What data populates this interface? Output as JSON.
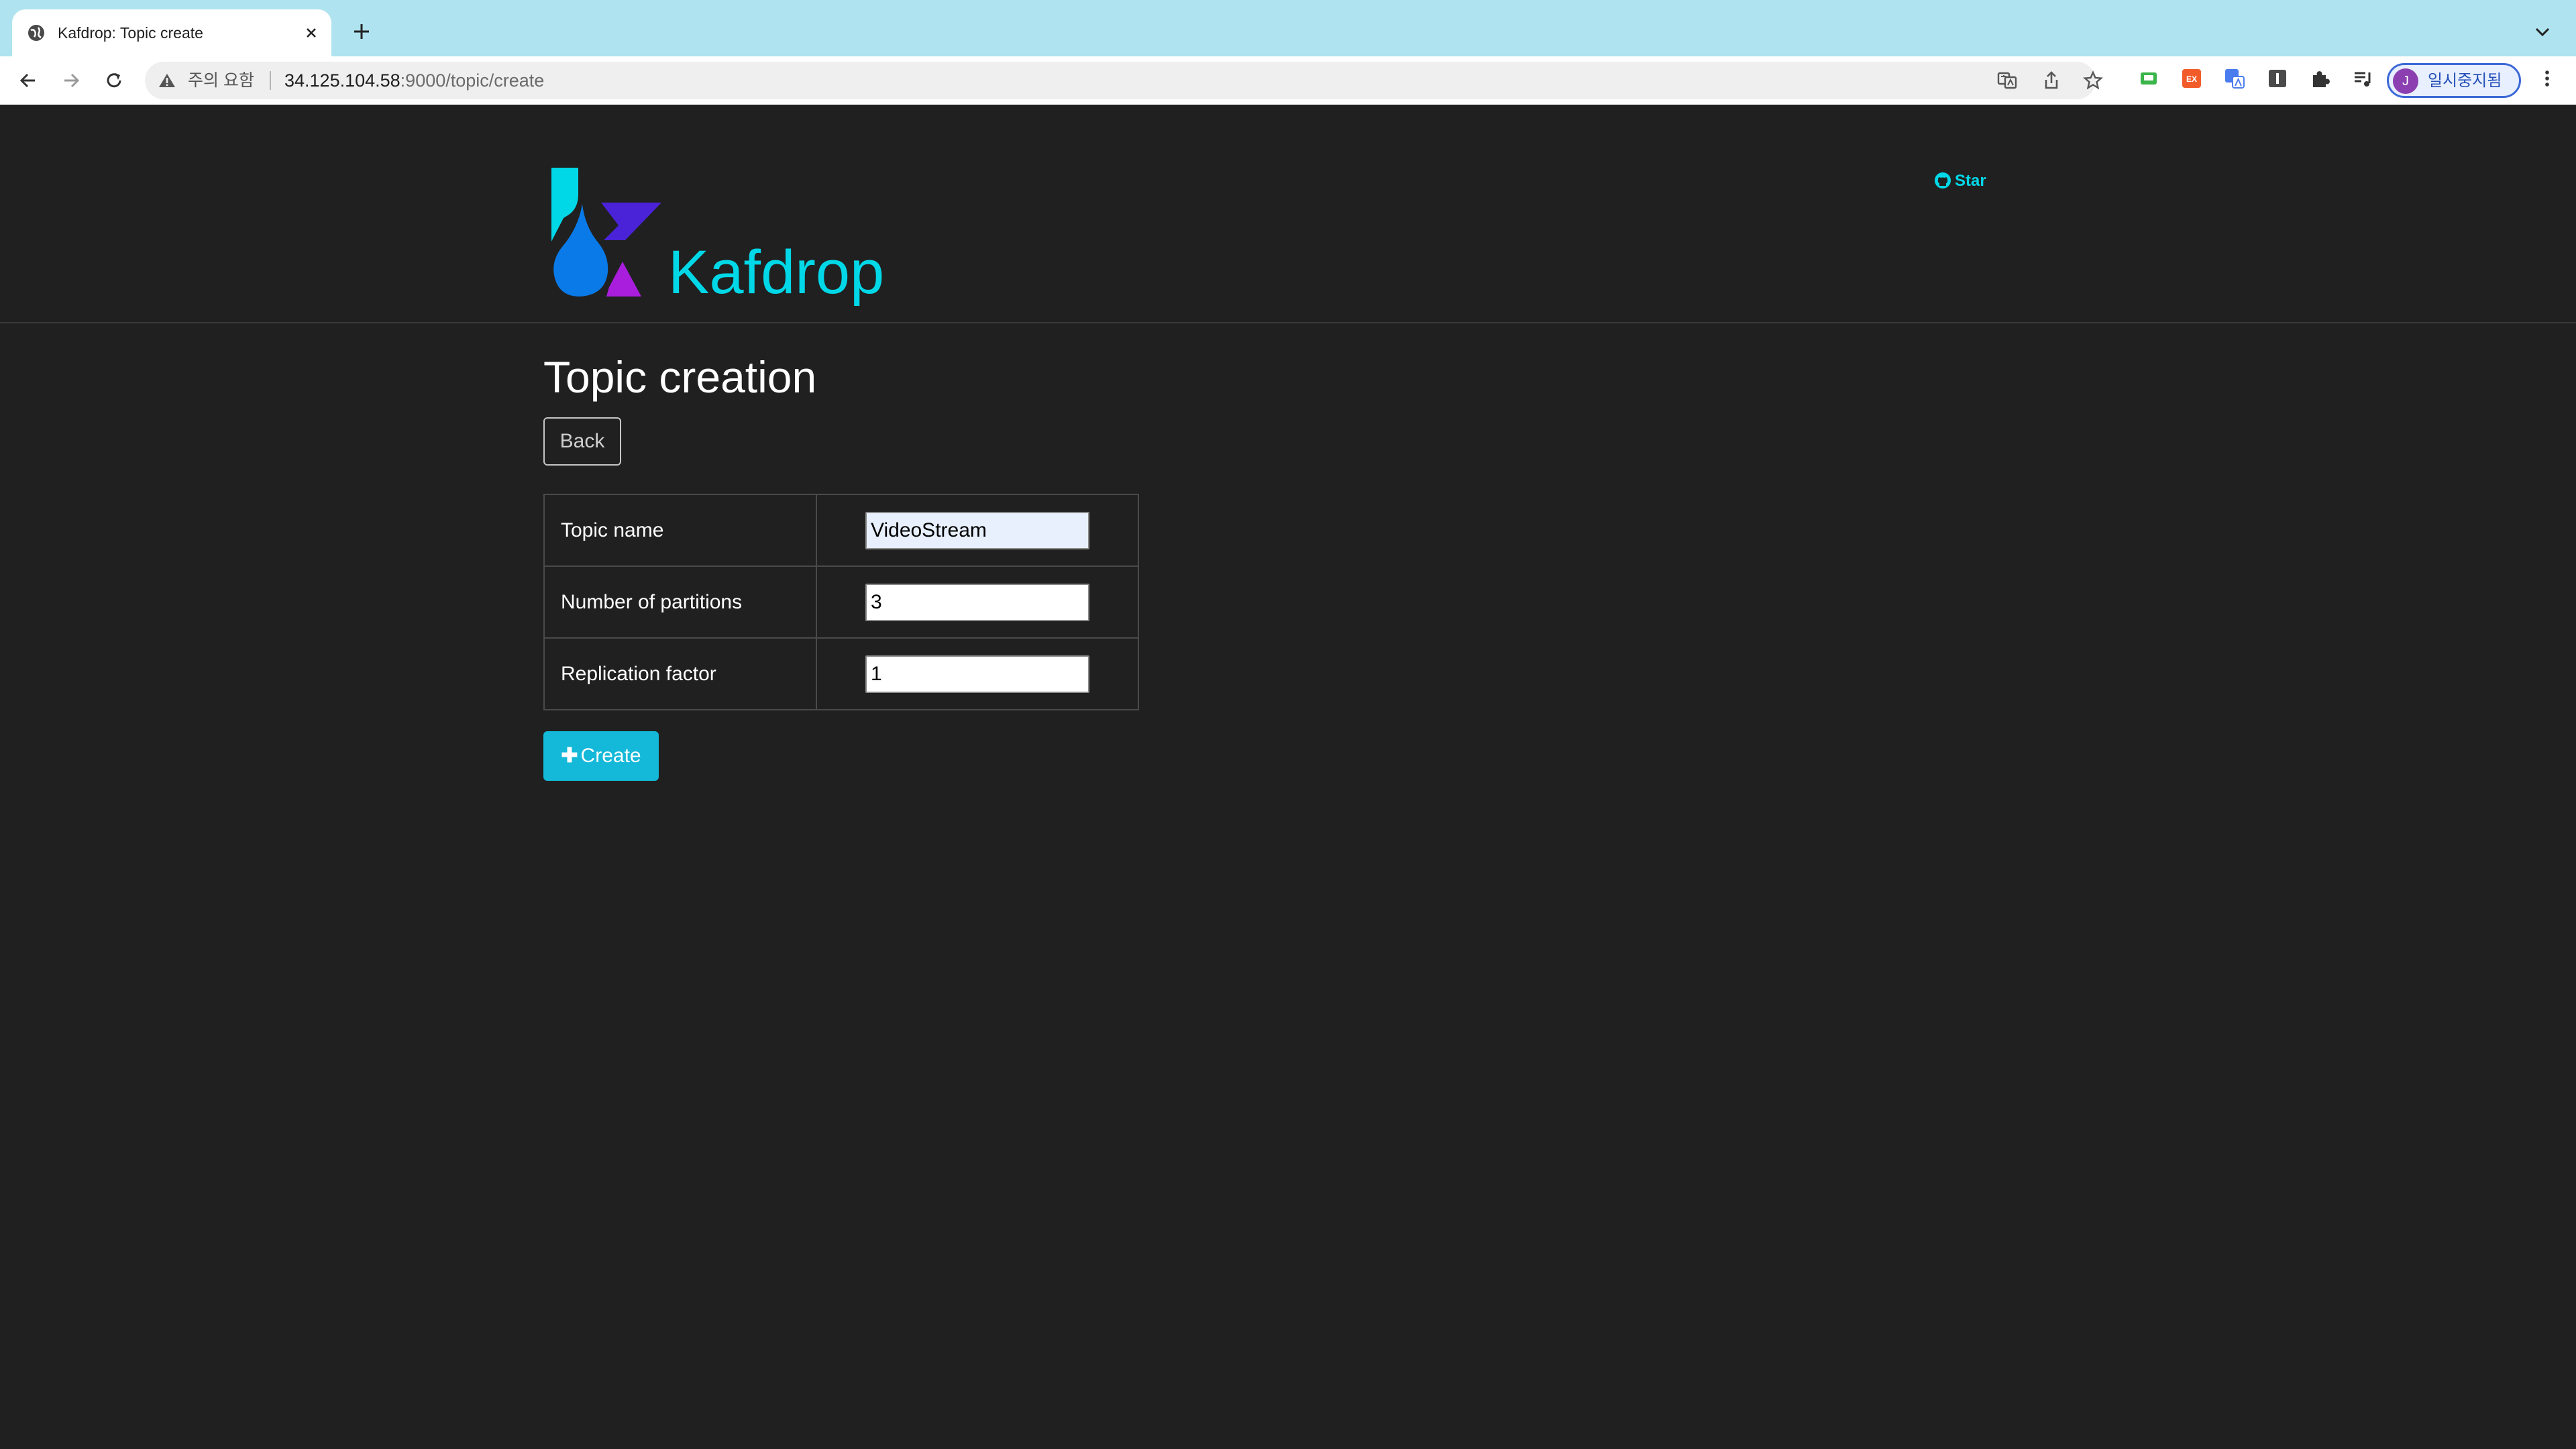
{
  "browser": {
    "tab_title": "Kafdrop: Topic create",
    "omnibox": {
      "security_label": "주의 요함",
      "url_host": "34.125.104.58",
      "url_rest": ":9000/topic/create"
    },
    "profile_initial": "J",
    "profile_label": "일시중지됨",
    "icons": {
      "tab_favicon": "globe-icon",
      "tab_close": "close-icon",
      "new_tab": "plus-icon",
      "tab_menu": "chevron-down-icon",
      "back": "arrow-left-icon",
      "forward": "arrow-right-icon",
      "reload": "reload-icon",
      "warning": "warning-icon",
      "translate": "translate-icon",
      "share": "share-icon",
      "bookmark": "star-outline-icon",
      "extensions": [
        "green-extension-icon",
        "ex-extension-icon",
        "translate-extension-icon",
        "dark-extension-icon",
        "puzzle-icon",
        "media-queue-icon"
      ],
      "menu": "kebab-menu-icon"
    },
    "colors": {
      "tab_strip": "#aee3ef",
      "profile_accent": "#3c69d6"
    }
  },
  "header": {
    "brand": "Kafdrop",
    "github_star_label": "Star",
    "icons": {
      "logo": "kafdrop-logo-icon",
      "github": "github-icon"
    },
    "colors": {
      "brand": "#00d8e8"
    }
  },
  "main": {
    "title": "Topic creation",
    "back_label": "Back",
    "form": {
      "rows": [
        {
          "label": "Topic name",
          "value": "VideoStream"
        },
        {
          "label": "Number of partitions",
          "value": "3"
        },
        {
          "label": "Replication factor",
          "value": "1"
        }
      ]
    },
    "create_label": "Create",
    "create_icon": "plus-icon",
    "colors": {
      "background": "#202020",
      "create_button": "#14b8d8"
    }
  }
}
